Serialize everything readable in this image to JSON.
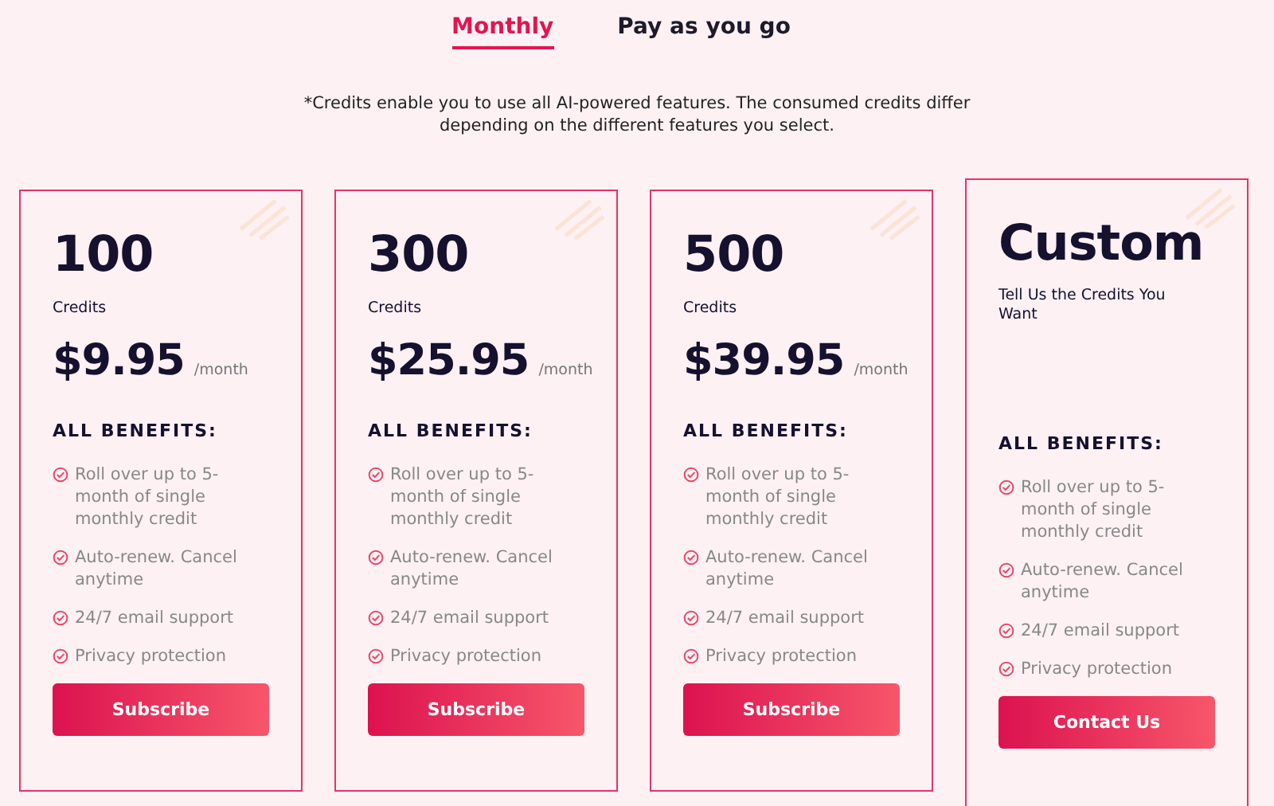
{
  "tabs": [
    {
      "label": "Monthly",
      "selected": true
    },
    {
      "label": "Pay as you go",
      "selected": false
    }
  ],
  "note": "*Credits enable you to use all AI-powered features. The consumed credits differ depending on the different features you select.",
  "plans": [
    {
      "kind": "credits",
      "amount": "100",
      "unit": "Credits",
      "price": "$9.95",
      "period": "/month",
      "benefits_title": "ALL BENEFITS:",
      "benefits": [
        "Roll over up to 5-month of single monthly credit",
        "Auto-renew. Cancel anytime",
        "24/7 email support",
        "Privacy protection"
      ],
      "button": "Subscribe"
    },
    {
      "kind": "credits",
      "amount": "300",
      "unit": "Credits",
      "price": "$25.95",
      "period": "/month",
      "benefits_title": "ALL BENEFITS:",
      "benefits": [
        "Roll over up to 5-month of single monthly credit",
        "Auto-renew. Cancel anytime",
        "24/7 email support",
        "Privacy protection"
      ],
      "button": "Subscribe"
    },
    {
      "kind": "credits",
      "amount": "500",
      "unit": "Credits",
      "price": "$39.95",
      "period": "/month",
      "benefits_title": "ALL BENEFITS:",
      "benefits": [
        "Roll over up to 5-month of single monthly credit",
        "Auto-renew. Cancel anytime",
        "24/7 email support",
        "Privacy protection"
      ],
      "button": "Subscribe"
    },
    {
      "kind": "custom",
      "amount": "Custom",
      "unit": "Tell Us the Credits You Want",
      "benefits_title": "ALL BENEFITS:",
      "benefits": [
        "Roll over up to 5-month of single monthly credit",
        "Auto-renew. Cancel anytime",
        "24/7 email support",
        "Privacy protection"
      ],
      "button": "Contact Us"
    }
  ]
}
